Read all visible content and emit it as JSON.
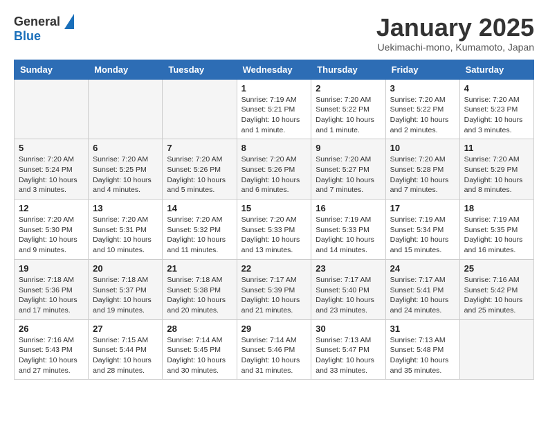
{
  "header": {
    "logo_general": "General",
    "logo_blue": "Blue",
    "month_title": "January 2025",
    "location": "Uekimachi-mono, Kumamoto, Japan"
  },
  "weekdays": [
    "Sunday",
    "Monday",
    "Tuesday",
    "Wednesday",
    "Thursday",
    "Friday",
    "Saturday"
  ],
  "weeks": [
    [
      {
        "day": "",
        "info": ""
      },
      {
        "day": "",
        "info": ""
      },
      {
        "day": "",
        "info": ""
      },
      {
        "day": "1",
        "info": "Sunrise: 7:19 AM\nSunset: 5:21 PM\nDaylight: 10 hours\nand 1 minute."
      },
      {
        "day": "2",
        "info": "Sunrise: 7:20 AM\nSunset: 5:22 PM\nDaylight: 10 hours\nand 1 minute."
      },
      {
        "day": "3",
        "info": "Sunrise: 7:20 AM\nSunset: 5:22 PM\nDaylight: 10 hours\nand 2 minutes."
      },
      {
        "day": "4",
        "info": "Sunrise: 7:20 AM\nSunset: 5:23 PM\nDaylight: 10 hours\nand 3 minutes."
      }
    ],
    [
      {
        "day": "5",
        "info": "Sunrise: 7:20 AM\nSunset: 5:24 PM\nDaylight: 10 hours\nand 3 minutes."
      },
      {
        "day": "6",
        "info": "Sunrise: 7:20 AM\nSunset: 5:25 PM\nDaylight: 10 hours\nand 4 minutes."
      },
      {
        "day": "7",
        "info": "Sunrise: 7:20 AM\nSunset: 5:26 PM\nDaylight: 10 hours\nand 5 minutes."
      },
      {
        "day": "8",
        "info": "Sunrise: 7:20 AM\nSunset: 5:26 PM\nDaylight: 10 hours\nand 6 minutes."
      },
      {
        "day": "9",
        "info": "Sunrise: 7:20 AM\nSunset: 5:27 PM\nDaylight: 10 hours\nand 7 minutes."
      },
      {
        "day": "10",
        "info": "Sunrise: 7:20 AM\nSunset: 5:28 PM\nDaylight: 10 hours\nand 7 minutes."
      },
      {
        "day": "11",
        "info": "Sunrise: 7:20 AM\nSunset: 5:29 PM\nDaylight: 10 hours\nand 8 minutes."
      }
    ],
    [
      {
        "day": "12",
        "info": "Sunrise: 7:20 AM\nSunset: 5:30 PM\nDaylight: 10 hours\nand 9 minutes."
      },
      {
        "day": "13",
        "info": "Sunrise: 7:20 AM\nSunset: 5:31 PM\nDaylight: 10 hours\nand 10 minutes."
      },
      {
        "day": "14",
        "info": "Sunrise: 7:20 AM\nSunset: 5:32 PM\nDaylight: 10 hours\nand 11 minutes."
      },
      {
        "day": "15",
        "info": "Sunrise: 7:20 AM\nSunset: 5:33 PM\nDaylight: 10 hours\nand 13 minutes."
      },
      {
        "day": "16",
        "info": "Sunrise: 7:19 AM\nSunset: 5:33 PM\nDaylight: 10 hours\nand 14 minutes."
      },
      {
        "day": "17",
        "info": "Sunrise: 7:19 AM\nSunset: 5:34 PM\nDaylight: 10 hours\nand 15 minutes."
      },
      {
        "day": "18",
        "info": "Sunrise: 7:19 AM\nSunset: 5:35 PM\nDaylight: 10 hours\nand 16 minutes."
      }
    ],
    [
      {
        "day": "19",
        "info": "Sunrise: 7:18 AM\nSunset: 5:36 PM\nDaylight: 10 hours\nand 17 minutes."
      },
      {
        "day": "20",
        "info": "Sunrise: 7:18 AM\nSunset: 5:37 PM\nDaylight: 10 hours\nand 19 minutes."
      },
      {
        "day": "21",
        "info": "Sunrise: 7:18 AM\nSunset: 5:38 PM\nDaylight: 10 hours\nand 20 minutes."
      },
      {
        "day": "22",
        "info": "Sunrise: 7:17 AM\nSunset: 5:39 PM\nDaylight: 10 hours\nand 21 minutes."
      },
      {
        "day": "23",
        "info": "Sunrise: 7:17 AM\nSunset: 5:40 PM\nDaylight: 10 hours\nand 23 minutes."
      },
      {
        "day": "24",
        "info": "Sunrise: 7:17 AM\nSunset: 5:41 PM\nDaylight: 10 hours\nand 24 minutes."
      },
      {
        "day": "25",
        "info": "Sunrise: 7:16 AM\nSunset: 5:42 PM\nDaylight: 10 hours\nand 25 minutes."
      }
    ],
    [
      {
        "day": "26",
        "info": "Sunrise: 7:16 AM\nSunset: 5:43 PM\nDaylight: 10 hours\nand 27 minutes."
      },
      {
        "day": "27",
        "info": "Sunrise: 7:15 AM\nSunset: 5:44 PM\nDaylight: 10 hours\nand 28 minutes."
      },
      {
        "day": "28",
        "info": "Sunrise: 7:14 AM\nSunset: 5:45 PM\nDaylight: 10 hours\nand 30 minutes."
      },
      {
        "day": "29",
        "info": "Sunrise: 7:14 AM\nSunset: 5:46 PM\nDaylight: 10 hours\nand 31 minutes."
      },
      {
        "day": "30",
        "info": "Sunrise: 7:13 AM\nSunset: 5:47 PM\nDaylight: 10 hours\nand 33 minutes."
      },
      {
        "day": "31",
        "info": "Sunrise: 7:13 AM\nSunset: 5:48 PM\nDaylight: 10 hours\nand 35 minutes."
      },
      {
        "day": "",
        "info": ""
      }
    ]
  ]
}
